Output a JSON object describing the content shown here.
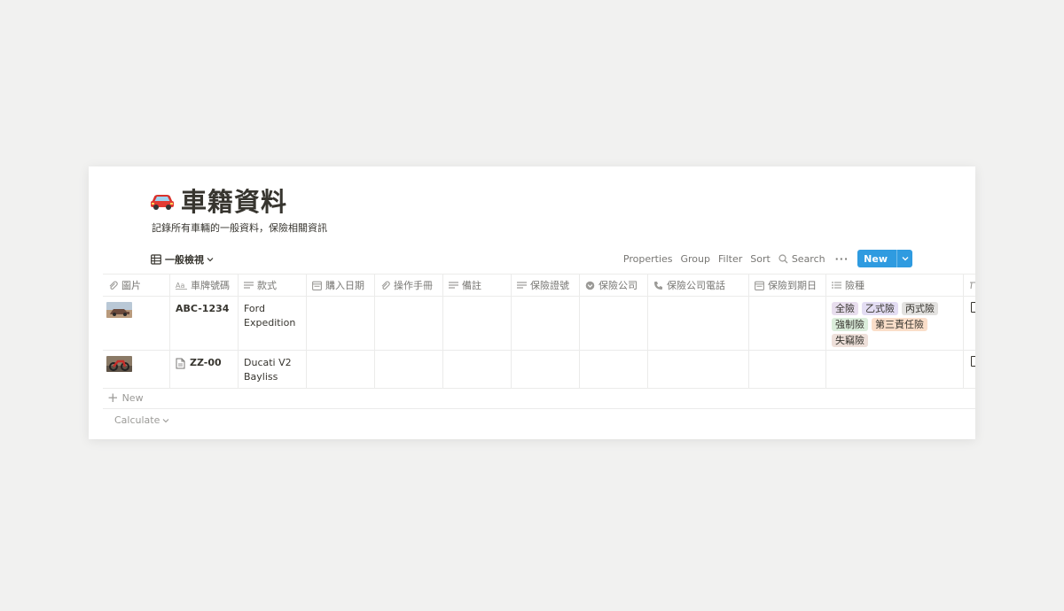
{
  "page": {
    "title": "車籍資料",
    "icon": "red-car-icon",
    "description": "記錄所有車輛的一般資料，保險相關資訊"
  },
  "view": {
    "name": "一般檢視",
    "icon": "table-icon"
  },
  "toolbar": {
    "properties": "Properties",
    "group": "Group",
    "filter": "Filter",
    "sort": "Sort",
    "search": "Search",
    "more": "···",
    "new": "New"
  },
  "columns": [
    {
      "label": "圖片",
      "icon": "paperclip-icon"
    },
    {
      "label": "車牌號碼",
      "icon": "title-icon"
    },
    {
      "label": "款式",
      "icon": "text-lines-icon"
    },
    {
      "label": "購入日期",
      "icon": "calendar-icon"
    },
    {
      "label": "操作手冊",
      "icon": "paperclip-icon"
    },
    {
      "label": "備註",
      "icon": "text-lines-icon"
    },
    {
      "label": "保險證號",
      "icon": "text-lines-icon"
    },
    {
      "label": "保險公司",
      "icon": "select-icon"
    },
    {
      "label": "保險公司電話",
      "icon": "phone-icon"
    },
    {
      "label": "保險到期日",
      "icon": "calendar-icon"
    },
    {
      "label": "險種",
      "icon": "list-icon"
    },
    {
      "label": "",
      "icon": "text-icon"
    }
  ],
  "rows": [
    {
      "plate": "ABC-1234",
      "model_line1": "Ford",
      "model_line2": "Expedition",
      "tags": [
        "全險",
        "乙式險",
        "丙式險",
        "強制險",
        "第三責任險",
        "失竊險"
      ]
    },
    {
      "plate": "ZZ-00",
      "model_line1": "Ducati V2",
      "model_line2": "Bayliss",
      "tags": []
    }
  ],
  "footer": {
    "new_row": "New",
    "calculate": "Calculate"
  },
  "colors": {
    "accent": "#2f9be0",
    "tag_purple": "#e8deee",
    "tag_violet": "#e3ddf3",
    "tag_gray": "#e3e2e0",
    "tag_green": "#dbeddb",
    "tag_orange": "#fadec9",
    "tag_brown": "#eee0da"
  }
}
